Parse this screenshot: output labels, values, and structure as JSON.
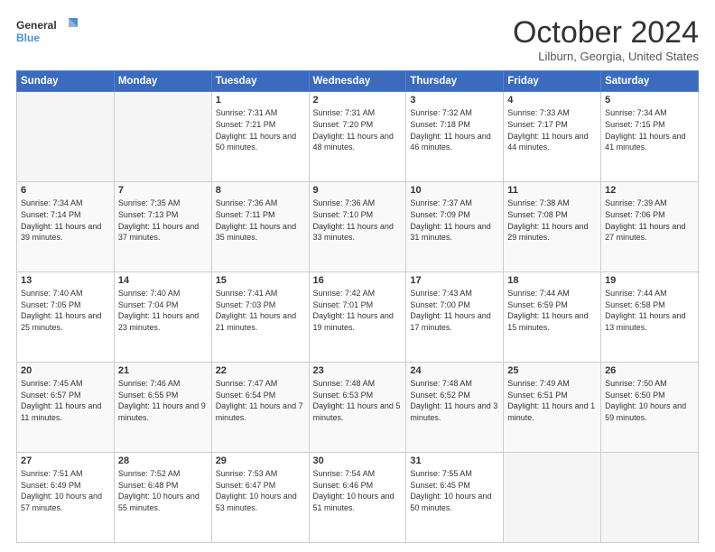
{
  "logo": {
    "line1": "General",
    "line2": "Blue"
  },
  "header": {
    "title": "October 2024",
    "location": "Lilburn, Georgia, United States"
  },
  "weekdays": [
    "Sunday",
    "Monday",
    "Tuesday",
    "Wednesday",
    "Thursday",
    "Friday",
    "Saturday"
  ],
  "weeks": [
    [
      {
        "day": "",
        "sunrise": "",
        "sunset": "",
        "daylight": ""
      },
      {
        "day": "",
        "sunrise": "",
        "sunset": "",
        "daylight": ""
      },
      {
        "day": "1",
        "sunrise": "Sunrise: 7:31 AM",
        "sunset": "Sunset: 7:21 PM",
        "daylight": "Daylight: 11 hours and 50 minutes."
      },
      {
        "day": "2",
        "sunrise": "Sunrise: 7:31 AM",
        "sunset": "Sunset: 7:20 PM",
        "daylight": "Daylight: 11 hours and 48 minutes."
      },
      {
        "day": "3",
        "sunrise": "Sunrise: 7:32 AM",
        "sunset": "Sunset: 7:18 PM",
        "daylight": "Daylight: 11 hours and 46 minutes."
      },
      {
        "day": "4",
        "sunrise": "Sunrise: 7:33 AM",
        "sunset": "Sunset: 7:17 PM",
        "daylight": "Daylight: 11 hours and 44 minutes."
      },
      {
        "day": "5",
        "sunrise": "Sunrise: 7:34 AM",
        "sunset": "Sunset: 7:15 PM",
        "daylight": "Daylight: 11 hours and 41 minutes."
      }
    ],
    [
      {
        "day": "6",
        "sunrise": "Sunrise: 7:34 AM",
        "sunset": "Sunset: 7:14 PM",
        "daylight": "Daylight: 11 hours and 39 minutes."
      },
      {
        "day": "7",
        "sunrise": "Sunrise: 7:35 AM",
        "sunset": "Sunset: 7:13 PM",
        "daylight": "Daylight: 11 hours and 37 minutes."
      },
      {
        "day": "8",
        "sunrise": "Sunrise: 7:36 AM",
        "sunset": "Sunset: 7:11 PM",
        "daylight": "Daylight: 11 hours and 35 minutes."
      },
      {
        "day": "9",
        "sunrise": "Sunrise: 7:36 AM",
        "sunset": "Sunset: 7:10 PM",
        "daylight": "Daylight: 11 hours and 33 minutes."
      },
      {
        "day": "10",
        "sunrise": "Sunrise: 7:37 AM",
        "sunset": "Sunset: 7:09 PM",
        "daylight": "Daylight: 11 hours and 31 minutes."
      },
      {
        "day": "11",
        "sunrise": "Sunrise: 7:38 AM",
        "sunset": "Sunset: 7:08 PM",
        "daylight": "Daylight: 11 hours and 29 minutes."
      },
      {
        "day": "12",
        "sunrise": "Sunrise: 7:39 AM",
        "sunset": "Sunset: 7:06 PM",
        "daylight": "Daylight: 11 hours and 27 minutes."
      }
    ],
    [
      {
        "day": "13",
        "sunrise": "Sunrise: 7:40 AM",
        "sunset": "Sunset: 7:05 PM",
        "daylight": "Daylight: 11 hours and 25 minutes."
      },
      {
        "day": "14",
        "sunrise": "Sunrise: 7:40 AM",
        "sunset": "Sunset: 7:04 PM",
        "daylight": "Daylight: 11 hours and 23 minutes."
      },
      {
        "day": "15",
        "sunrise": "Sunrise: 7:41 AM",
        "sunset": "Sunset: 7:03 PM",
        "daylight": "Daylight: 11 hours and 21 minutes."
      },
      {
        "day": "16",
        "sunrise": "Sunrise: 7:42 AM",
        "sunset": "Sunset: 7:01 PM",
        "daylight": "Daylight: 11 hours and 19 minutes."
      },
      {
        "day": "17",
        "sunrise": "Sunrise: 7:43 AM",
        "sunset": "Sunset: 7:00 PM",
        "daylight": "Daylight: 11 hours and 17 minutes."
      },
      {
        "day": "18",
        "sunrise": "Sunrise: 7:44 AM",
        "sunset": "Sunset: 6:59 PM",
        "daylight": "Daylight: 11 hours and 15 minutes."
      },
      {
        "day": "19",
        "sunrise": "Sunrise: 7:44 AM",
        "sunset": "Sunset: 6:58 PM",
        "daylight": "Daylight: 11 hours and 13 minutes."
      }
    ],
    [
      {
        "day": "20",
        "sunrise": "Sunrise: 7:45 AM",
        "sunset": "Sunset: 6:57 PM",
        "daylight": "Daylight: 11 hours and 11 minutes."
      },
      {
        "day": "21",
        "sunrise": "Sunrise: 7:46 AM",
        "sunset": "Sunset: 6:55 PM",
        "daylight": "Daylight: 11 hours and 9 minutes."
      },
      {
        "day": "22",
        "sunrise": "Sunrise: 7:47 AM",
        "sunset": "Sunset: 6:54 PM",
        "daylight": "Daylight: 11 hours and 7 minutes."
      },
      {
        "day": "23",
        "sunrise": "Sunrise: 7:48 AM",
        "sunset": "Sunset: 6:53 PM",
        "daylight": "Daylight: 11 hours and 5 minutes."
      },
      {
        "day": "24",
        "sunrise": "Sunrise: 7:48 AM",
        "sunset": "Sunset: 6:52 PM",
        "daylight": "Daylight: 11 hours and 3 minutes."
      },
      {
        "day": "25",
        "sunrise": "Sunrise: 7:49 AM",
        "sunset": "Sunset: 6:51 PM",
        "daylight": "Daylight: 11 hours and 1 minute."
      },
      {
        "day": "26",
        "sunrise": "Sunrise: 7:50 AM",
        "sunset": "Sunset: 6:50 PM",
        "daylight": "Daylight: 10 hours and 59 minutes."
      }
    ],
    [
      {
        "day": "27",
        "sunrise": "Sunrise: 7:51 AM",
        "sunset": "Sunset: 6:49 PM",
        "daylight": "Daylight: 10 hours and 57 minutes."
      },
      {
        "day": "28",
        "sunrise": "Sunrise: 7:52 AM",
        "sunset": "Sunset: 6:48 PM",
        "daylight": "Daylight: 10 hours and 55 minutes."
      },
      {
        "day": "29",
        "sunrise": "Sunrise: 7:53 AM",
        "sunset": "Sunset: 6:47 PM",
        "daylight": "Daylight: 10 hours and 53 minutes."
      },
      {
        "day": "30",
        "sunrise": "Sunrise: 7:54 AM",
        "sunset": "Sunset: 6:46 PM",
        "daylight": "Daylight: 10 hours and 51 minutes."
      },
      {
        "day": "31",
        "sunrise": "Sunrise: 7:55 AM",
        "sunset": "Sunset: 6:45 PM",
        "daylight": "Daylight: 10 hours and 50 minutes."
      },
      {
        "day": "",
        "sunrise": "",
        "sunset": "",
        "daylight": ""
      },
      {
        "day": "",
        "sunrise": "",
        "sunset": "",
        "daylight": ""
      }
    ]
  ]
}
